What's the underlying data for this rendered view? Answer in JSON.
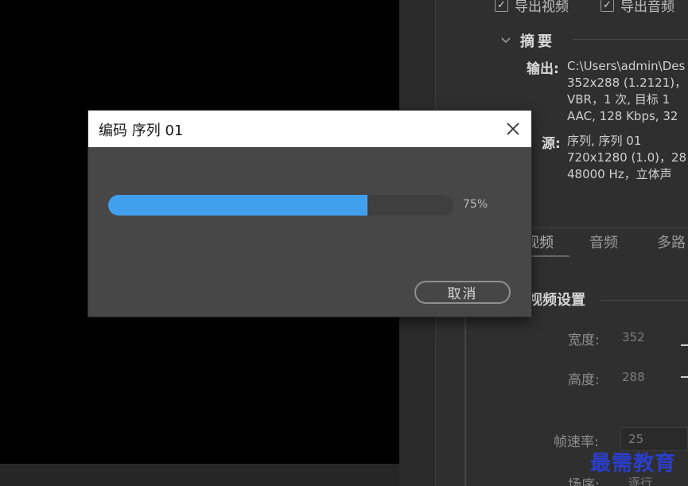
{
  "export_panel": {
    "checkbox_export_video": "导出视频",
    "checkbox_export_audio": "导出音频",
    "summary_title": "摘要",
    "output_label": "输出:",
    "output_lines": [
      "C:\\Users\\admin\\Des",
      "352x288  (1.2121)，",
      "VBR，1 次, 目标 1",
      "AAC, 128 Kbps, 32"
    ],
    "source_label": "源:",
    "source_lines": [
      "序列, 序列 01",
      "720x1280  (1.0)，28",
      "48000 Hz，立体声"
    ],
    "tabs": [
      "视频",
      "音频",
      "多路"
    ],
    "video_settings_title": "视频设置",
    "width_label": "宽度:",
    "width_value": "352",
    "height_label": "高度:",
    "height_value": "288",
    "frame_rate_label": "帧速率:",
    "frame_rate_value": "25",
    "field_order_label": "场序:",
    "field_order_value": "逐行"
  },
  "dialog": {
    "title": "编码 序列 01",
    "progress": 0.75,
    "progress_label": "75%",
    "cancel_label": "取消"
  },
  "watermark": "最需教育",
  "colors": {
    "progress_fill": "#41a0ee",
    "dialog_bg": "#474747",
    "titlebar_bg": "#ffffff"
  }
}
